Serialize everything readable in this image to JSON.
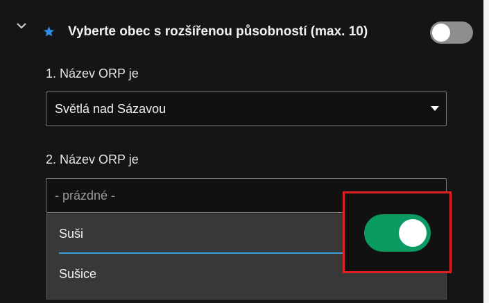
{
  "header": {
    "title": "Vyberte obec s rozšířenou působností (max. 10)",
    "expand_icon": "chevron-down-icon",
    "star_icon": "star-icon",
    "star_color": "#2e8ce6",
    "toggle_state": "off"
  },
  "fields": [
    {
      "label": "1. Název ORP je",
      "value": "Světlá nad Sázavou"
    },
    {
      "label": "2. Název ORP je",
      "placeholder": "- prázdné -"
    }
  ],
  "dropdown": {
    "options": [
      {
        "label": "Suši",
        "active": true
      },
      {
        "label": "Sušice",
        "active": false
      }
    ]
  },
  "highlight": {
    "border_color": "#e02020",
    "toggle_state": "on",
    "toggle_color": "#0a9a62"
  },
  "colors": {
    "background": "#151515",
    "accent_underline": "#3aa0d8"
  }
}
